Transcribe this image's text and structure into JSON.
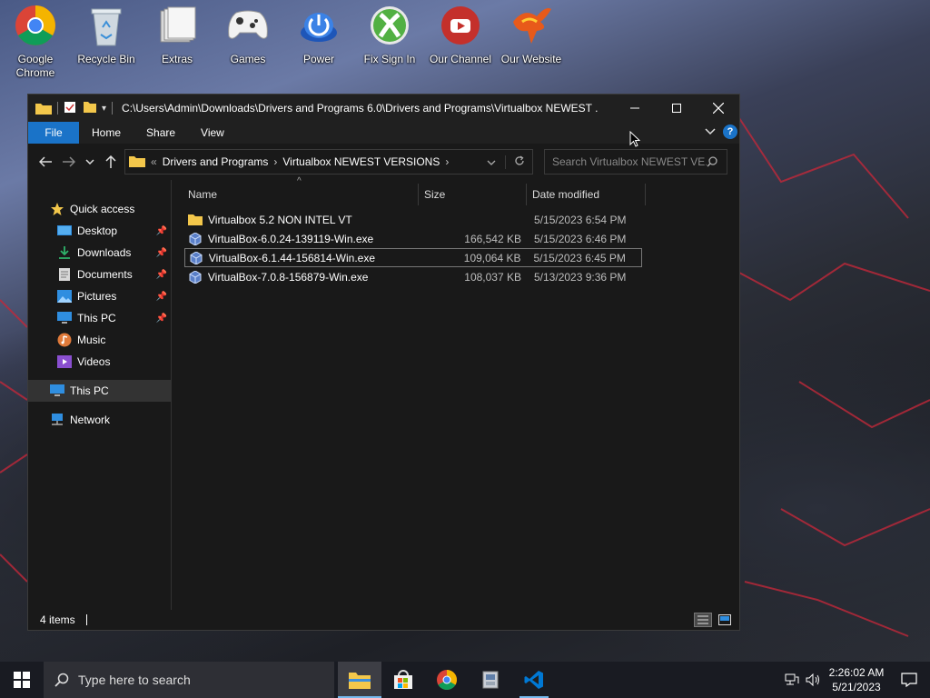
{
  "desktop": {
    "icons": [
      {
        "label": "Google Chrome",
        "icon": "chrome-icon"
      },
      {
        "label": "Recycle Bin",
        "icon": "recycle-bin-icon"
      },
      {
        "label": "Extras",
        "icon": "extras-icon"
      },
      {
        "label": "Games",
        "icon": "gamepad-icon"
      },
      {
        "label": "Power",
        "icon": "power-icon"
      },
      {
        "label": "Fix Sign In",
        "icon": "xbox-icon"
      },
      {
        "label": "Our Channel",
        "icon": "youtube-icon"
      },
      {
        "label": "Our Website",
        "icon": "phoenix-icon"
      }
    ]
  },
  "window": {
    "title": "C:\\Users\\Admin\\Downloads\\Drivers and Programs 6.0\\Drivers and Programs\\Virtualbox NEWEST ...",
    "ribbon_tabs": [
      "File",
      "Home",
      "Share",
      "View"
    ],
    "breadcrumb": [
      "Drivers and Programs",
      "Virtualbox NEWEST VERSIONS"
    ],
    "search_placeholder": "Search Virtualbox NEWEST VE...",
    "columns": {
      "name": "Name",
      "size": "Size",
      "date": "Date modified"
    },
    "nav": {
      "quick_access": "Quick access",
      "items": [
        "Desktop",
        "Downloads",
        "Documents",
        "Pictures",
        "This PC",
        "Music",
        "Videos"
      ],
      "this_pc": "This PC",
      "network": "Network"
    },
    "files": [
      {
        "name": "Virtualbox 5.2 NON INTEL VT",
        "size": "",
        "date": "5/15/2023 6:54 PM",
        "type": "folder"
      },
      {
        "name": "VirtualBox-6.0.24-139119-Win.exe",
        "size": "166,542 KB",
        "date": "5/15/2023 6:46 PM",
        "type": "exe"
      },
      {
        "name": "VirtualBox-6.1.44-156814-Win.exe",
        "size": "109,064 KB",
        "date": "5/15/2023 6:45 PM",
        "type": "exe"
      },
      {
        "name": "VirtualBox-7.0.8-156879-Win.exe",
        "size": "108,037 KB",
        "date": "5/13/2023 9:36 PM",
        "type": "exe"
      }
    ],
    "status": "4 items"
  },
  "taskbar": {
    "search_placeholder": "Type here to search",
    "time": "2:26:02 AM",
    "date": "5/21/2023"
  },
  "colors": {
    "accent": "#1a73c8",
    "window_bg": "#191919"
  }
}
